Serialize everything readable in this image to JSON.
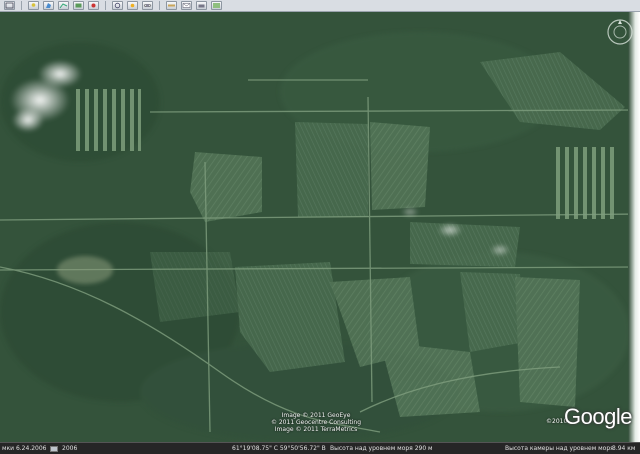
{
  "toolbar": {
    "icons": [
      "sidebar-icon",
      "placemark-icon",
      "polygon-icon",
      "path-icon",
      "overlay-icon",
      "tour-icon",
      "history-icon",
      "sun-icon",
      "planet-icon",
      "ruler-icon",
      "email-icon",
      "print-icon",
      "map-icon"
    ]
  },
  "map": {
    "credits": [
      "Image © 2011 GeoEye",
      "© 2011 Geocentre Consulting",
      "Image © 2011 TerraMetrics"
    ],
    "logo_text": "Google",
    "logo_year": "©2010"
  },
  "statusbar": {
    "tour_date": "мки 6.24.2006",
    "year": "2006",
    "coords": "61°19'08.75\" С   59°50'56.72\" В",
    "elevation": "Высота над уровнем моря   290 м",
    "eye_alt": "Высота камеры над уровнем моря",
    "distance": "3.94 км"
  },
  "colors": {
    "forest": "#33513a",
    "clearing": "#5f8264",
    "statusbar": "#262626"
  }
}
